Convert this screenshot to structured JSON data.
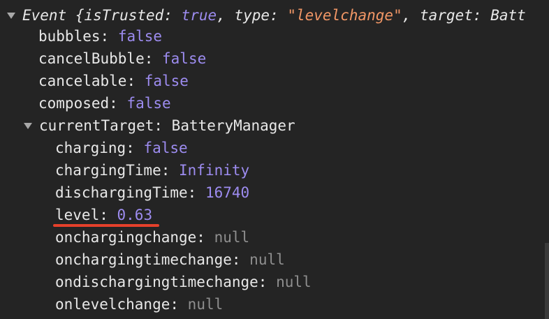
{
  "event": {
    "prefix": "Event {",
    "is_trusted_key": "isTrusted",
    "is_trusted_value": "true",
    "type_key": "type",
    "type_value": "\"levelchange\"",
    "target_key": "target",
    "target_value": "Batt"
  },
  "properties": [
    {
      "key": "bubbles",
      "value": "false"
    },
    {
      "key": "cancelBubble",
      "value": "false"
    },
    {
      "key": "cancelable",
      "value": "false"
    },
    {
      "key": "composed",
      "value": "false"
    }
  ],
  "current_target": {
    "key": "currentTarget",
    "value": "BatteryManager",
    "children": [
      {
        "key": "charging",
        "value": "false"
      },
      {
        "key": "chargingTime",
        "value": "Infinity"
      },
      {
        "key": "dischargingTime",
        "value": "16740"
      },
      {
        "key": "level",
        "value": "0.63"
      },
      {
        "key": "onchargingchange",
        "value": "null"
      },
      {
        "key": "onchargingtimechange",
        "value": "null"
      },
      {
        "key": "ondischargingtimechange",
        "value": "null"
      },
      {
        "key": "onlevelchange",
        "value": "null"
      }
    ]
  },
  "colors": {
    "background": "#242424",
    "key": "#e8e8e8",
    "boolean_number": "#9d8cf0",
    "string": "#f29766",
    "null": "#8f8f8f",
    "highlight_underline": "#e5402b"
  }
}
